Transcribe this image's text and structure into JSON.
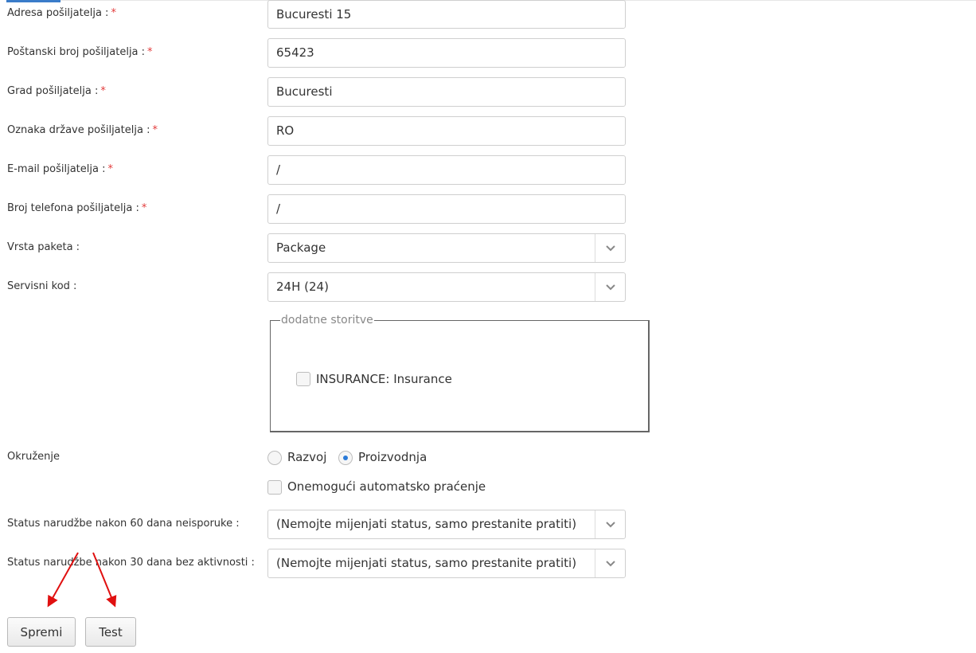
{
  "required_mark": "*",
  "fields": [
    {
      "label": "Adresa pošiljatelja :",
      "value": "Bucuresti 15",
      "required": true
    },
    {
      "label": "Poštanski broj pošiljatelja :",
      "value": "65423",
      "required": true
    },
    {
      "label": "Grad pošiljatelja :",
      "value": "Bucuresti",
      "required": true
    },
    {
      "label": "Oznaka države pošiljatelja :",
      "value": "RO",
      "required": true
    },
    {
      "label": "E-mail pošiljatelja :",
      "value": "/",
      "required": true
    },
    {
      "label": "Broj telefona pošiljatelja :",
      "value": "/",
      "required": true
    }
  ],
  "package_type": {
    "label": "Vrsta paketa :",
    "value": "Package"
  },
  "service_code": {
    "label": "Servisni kod :",
    "value": "24H (24)"
  },
  "additional_services": {
    "legend": "dodatne storitve",
    "options": [
      {
        "label": "INSURANCE: Insurance",
        "checked": false
      }
    ]
  },
  "environment": {
    "label": "Okruženje",
    "options": [
      {
        "label": "Razvoj",
        "selected": false
      },
      {
        "label": "Proizvodnja",
        "selected": true
      }
    ]
  },
  "disable_tracking": {
    "label": "Onemogući automatsko praćenje",
    "checked": false
  },
  "status_60": {
    "label": "Status narudžbe nakon 60 dana neisporuke :",
    "value": "(Nemojte mijenjati status, samo prestanite pratiti)"
  },
  "status_30": {
    "label": "Status narudžbe nakon 30 dana bez aktivnosti :",
    "value": "(Nemojte mijenjati status, samo prestanite pratiti)"
  },
  "buttons": {
    "save": "Spremi",
    "test": "Test"
  },
  "colors": {
    "accent": "#2a7ad8",
    "required": "#e23b3b",
    "annotation_arrow": "#e01010"
  },
  "icons": {
    "select_arrow": "chevron-down-icon",
    "annotation": "red-arrow-annotation"
  }
}
